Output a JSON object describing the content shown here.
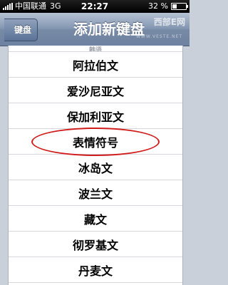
{
  "status_bar": {
    "carrier": "中国联通",
    "network": "3G",
    "time": "22:27",
    "battery_percent": "32 %",
    "battery_level": 0.32
  },
  "nav": {
    "back_label": "键盘",
    "title": "添加新键盘",
    "watermark": "西部E网",
    "watermark_url": "WWW.VESTE.NET"
  },
  "table": {
    "partial_top": "韩语",
    "rows": [
      "阿拉伯文",
      "爱沙尼亚文",
      "保加利亚文",
      "表情符号",
      "冰岛文",
      "波兰文",
      "藏文",
      "彻罗基文",
      "丹麦文"
    ],
    "highlighted_row": "表情符号"
  },
  "colors": {
    "highlight": "#d11a1a",
    "nav": "#778aa5"
  }
}
